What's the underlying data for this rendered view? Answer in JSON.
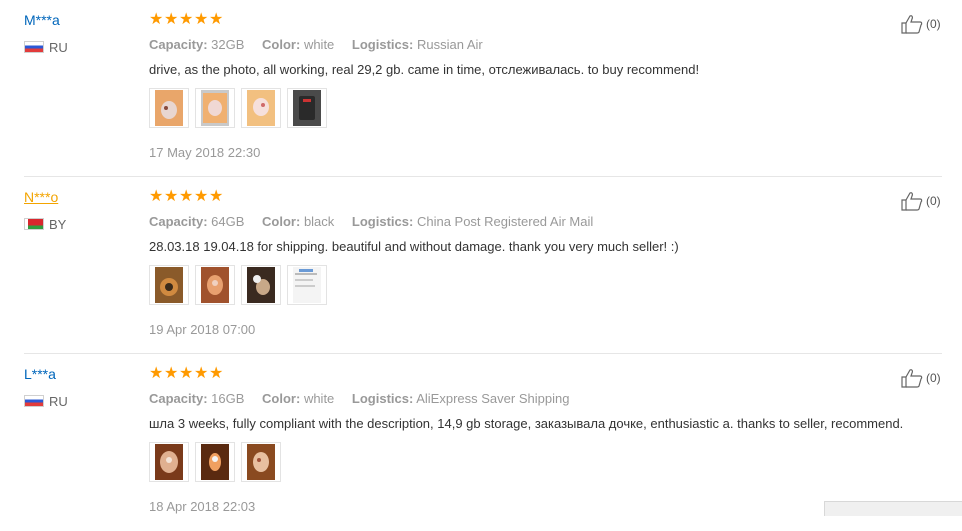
{
  "labels": {
    "capacity": "Capacity:",
    "color": "Color:",
    "logistics": "Logistics:"
  },
  "reviews": [
    {
      "user": "M***a",
      "country": "RU",
      "rating": 5,
      "capacity": "32GB",
      "color": "white",
      "logistics": "Russian Air",
      "text": "drive, as the photo, all working, real 29,2 gb. came in time, отслеживалась. to buy recommend!",
      "date": "17 May 2018 22:30",
      "likes": "(0)",
      "photo_count": 4
    },
    {
      "user": "N***o",
      "country": "BY",
      "rating": 5,
      "capacity": "64GB",
      "color": "black",
      "logistics": "China Post Registered Air Mail",
      "text": "28.03.18 19.04.18 for shipping. beautiful and without damage. thank you very much seller! :)",
      "date": "19 Apr 2018 07:00",
      "likes": "(0)",
      "photo_count": 4
    },
    {
      "user": "L***a",
      "country": "RU",
      "rating": 5,
      "capacity": "16GB",
      "color": "white",
      "logistics": "AliExpress Saver Shipping",
      "text": "шла 3 weeks, fully compliant with the description, 14,9 gb storage, заказывала дочке, enthusiastic a. thanks to seller, recommend.",
      "date": "18 Apr 2018 22:03",
      "likes": "(0)",
      "photo_count": 3
    }
  ],
  "colors": {
    "username": "#0066bb",
    "username_highlight": "#f3a400",
    "star": "#ff9a00",
    "muted": "#999999"
  },
  "icons": {
    "like": "thumbs-up-icon",
    "star": "star-icon"
  }
}
